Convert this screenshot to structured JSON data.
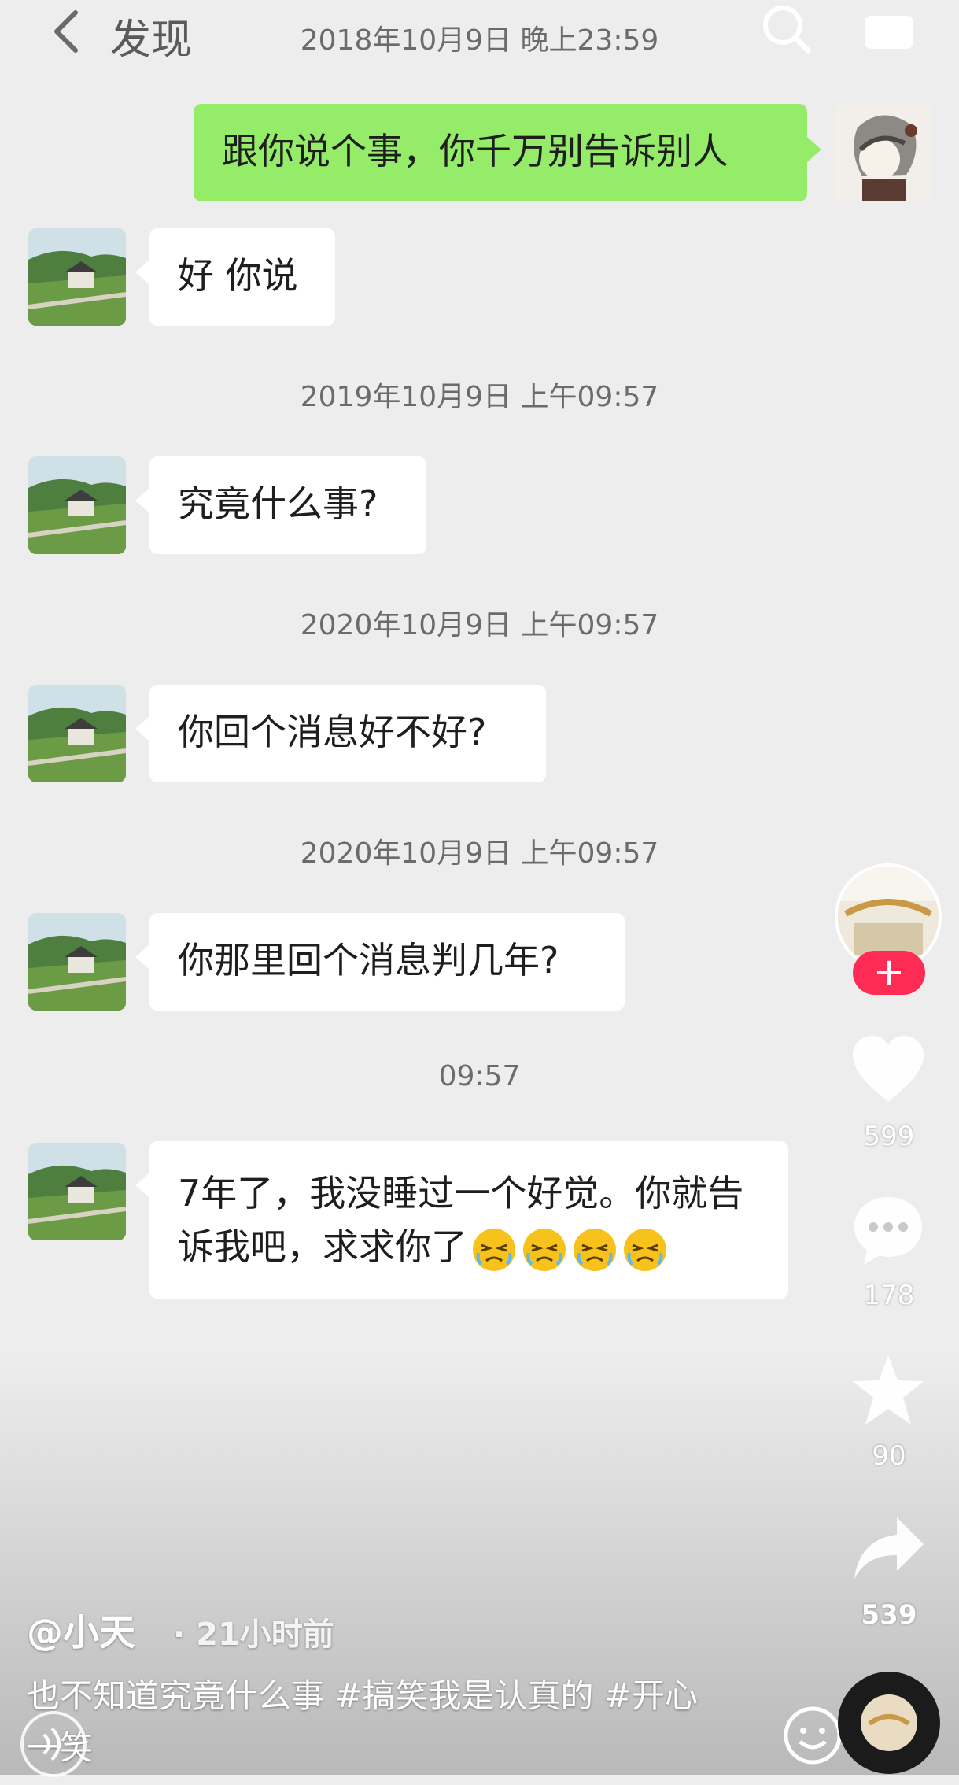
{
  "header": {
    "back_label": "发现",
    "timestamp": "2018年10月9日 晚上23:59"
  },
  "messages": [
    {
      "side": "out",
      "text": "跟你说个事，你千万别告诉别人"
    },
    {
      "side": "in",
      "text": "好 你说"
    },
    {
      "side": "time",
      "text": "2019年10月9日 上午09:57"
    },
    {
      "side": "in",
      "text": "究竟什么事?"
    },
    {
      "side": "time",
      "text": "2020年10月9日 上午09:57"
    },
    {
      "side": "in",
      "text": "你回个消息好不好?"
    },
    {
      "side": "time",
      "text": "2020年10月9日 上午09:57"
    },
    {
      "side": "in",
      "text": "你那里回个消息判几年?"
    },
    {
      "side": "time",
      "text": "09:57"
    },
    {
      "side": "in",
      "text": "7年了，我没睡过一个好觉。你就告诉我吧，求求你了",
      "emoji_count": 4
    }
  ],
  "actions": {
    "follow_label": "+",
    "likes": "599",
    "comments": "178",
    "favorites": "90",
    "shares": "539"
  },
  "post": {
    "author": "@小天",
    "time": "· 21小时前",
    "caption": "也不知道究竟什么事 #搞笑我是认真的 #开心一笑"
  },
  "colors": {
    "bg": "#ededed",
    "out_bubble": "#95ec69",
    "in_bubble": "#ffffff",
    "follow": "#fe2c55"
  },
  "icons": [
    "back-chevron-icon",
    "search-icon",
    "video-call-icon",
    "heart-icon",
    "comment-icon",
    "star-icon",
    "share-icon",
    "sound-icon",
    "emoji-icon",
    "music-disc-icon"
  ]
}
